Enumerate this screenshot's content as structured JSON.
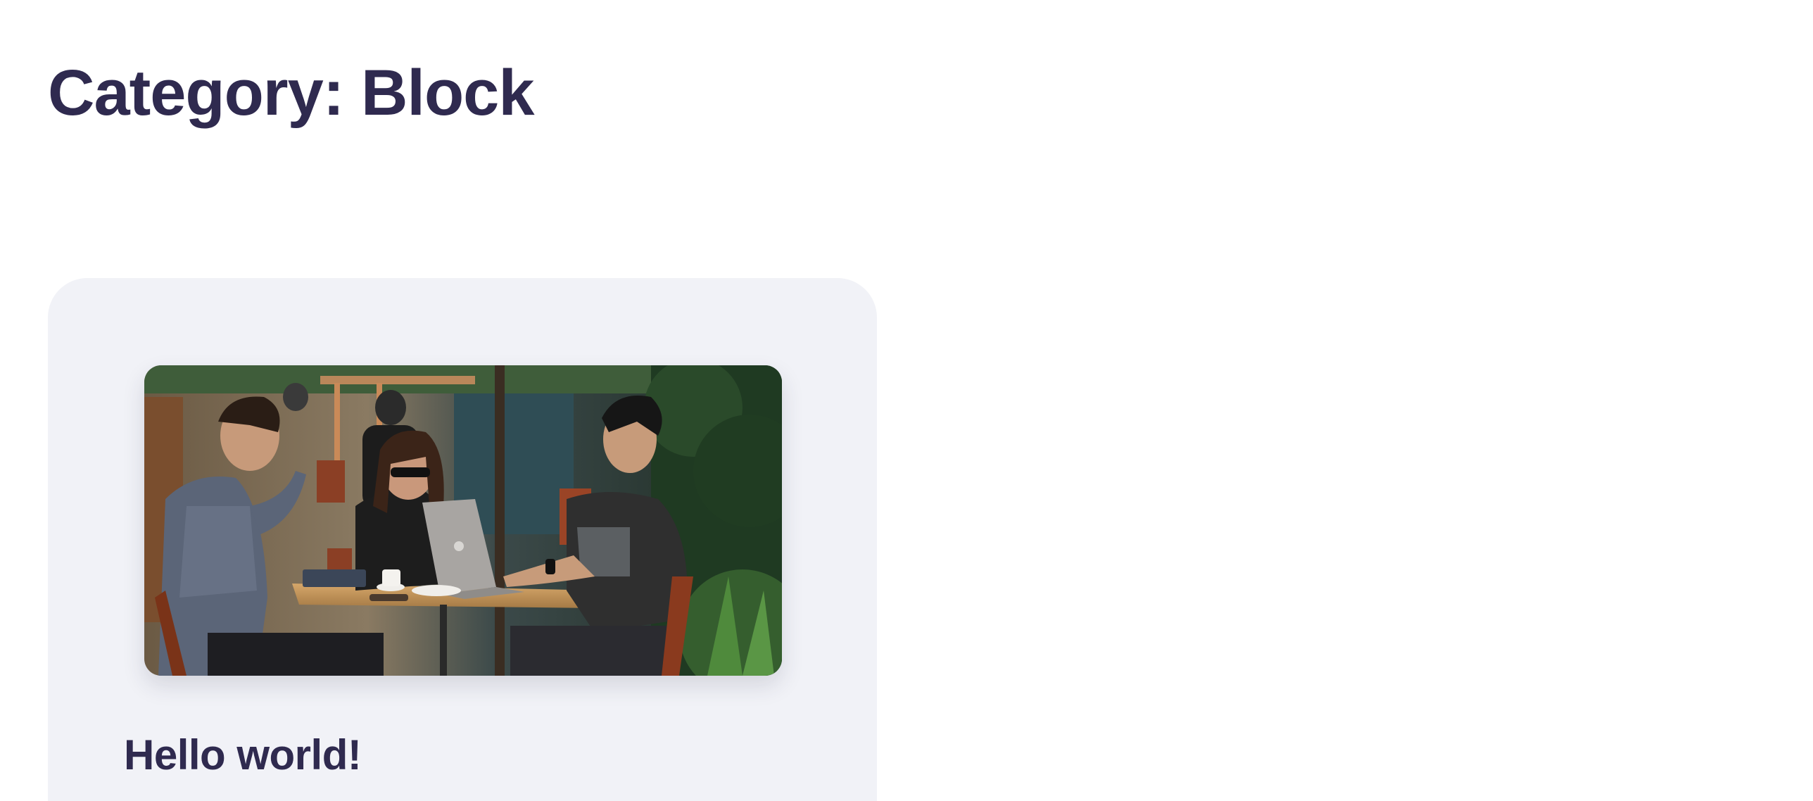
{
  "archive": {
    "title": "Category: Block"
  },
  "posts": [
    {
      "title": "Hello world!",
      "image_alt": "Three people sitting at an outdoor cafe table around a laptop"
    }
  ],
  "colors": {
    "heading": "#2f2a4f",
    "card_background": "#f1f2f7",
    "page_background": "#ffffff"
  }
}
